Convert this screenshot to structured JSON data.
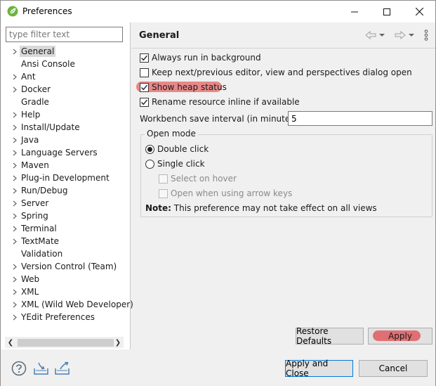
{
  "window": {
    "title": "Preferences",
    "accent": "#6db33f"
  },
  "filter": {
    "placeholder": "type filter text",
    "value": ""
  },
  "tree": [
    {
      "label": "General",
      "expandable": true,
      "selected": true
    },
    {
      "label": "Ansi Console",
      "expandable": false
    },
    {
      "label": "Ant",
      "expandable": true
    },
    {
      "label": "Docker",
      "expandable": true
    },
    {
      "label": "Gradle",
      "expandable": false
    },
    {
      "label": "Help",
      "expandable": true
    },
    {
      "label": "Install/Update",
      "expandable": true
    },
    {
      "label": "Java",
      "expandable": true
    },
    {
      "label": "Language Servers",
      "expandable": true
    },
    {
      "label": "Maven",
      "expandable": true
    },
    {
      "label": "Plug-in Development",
      "expandable": true
    },
    {
      "label": "Run/Debug",
      "expandable": true
    },
    {
      "label": "Server",
      "expandable": true
    },
    {
      "label": "Spring",
      "expandable": true
    },
    {
      "label": "Terminal",
      "expandable": true
    },
    {
      "label": "TextMate",
      "expandable": true
    },
    {
      "label": "Validation",
      "expandable": false
    },
    {
      "label": "Version Control (Team)",
      "expandable": true
    },
    {
      "label": "Web",
      "expandable": true
    },
    {
      "label": "XML",
      "expandable": true
    },
    {
      "label": "XML (Wild Web Developer)",
      "expandable": true
    },
    {
      "label": "YEdit Preferences",
      "expandable": true
    }
  ],
  "page": {
    "title": "General",
    "options": {
      "always_run": {
        "label": "Always run in background",
        "checked": true
      },
      "keep_next": {
        "label": "Keep next/previous editor, view and perspectives dialog open",
        "checked": false
      },
      "heap_status": {
        "label": "Show heap status",
        "checked": true
      },
      "rename_inline": {
        "label": "Rename resource inline if available",
        "checked": true
      }
    },
    "save_interval": {
      "label": "Workbench save interval (in minutes):",
      "value": "5"
    },
    "open_mode": {
      "title": "Open mode",
      "double_click": "Double click",
      "single_click": "Single click",
      "select_hover": "Select on hover",
      "open_arrow": "Open when using arrow keys",
      "note_bold": "Note:",
      "note_text": " This preference may not take effect on all views",
      "selected": "double_click"
    }
  },
  "buttons": {
    "restore_defaults": "Restore Defaults",
    "apply": "Apply",
    "apply_and_close": "Apply and Close",
    "cancel": "Cancel"
  },
  "colors": {
    "highlight": "#e57c7c",
    "default_button_border": "#0078d7"
  }
}
